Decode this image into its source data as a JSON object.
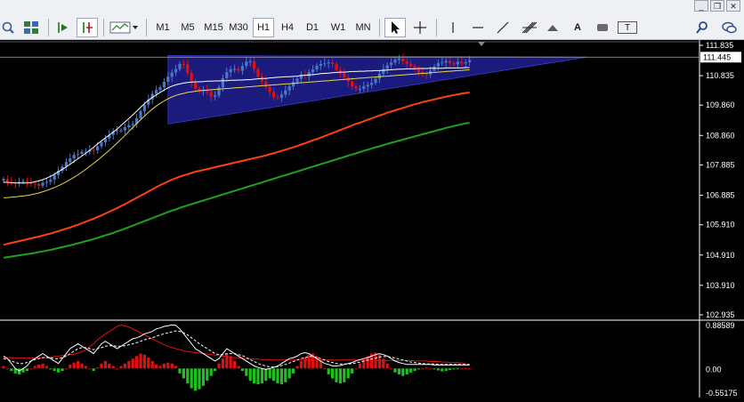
{
  "window": {
    "minimize": "_",
    "restore": "❐",
    "close": "✕"
  },
  "toolbar": {
    "timeframes": [
      "M1",
      "M5",
      "M15",
      "M30",
      "H1",
      "H4",
      "D1",
      "W1",
      "MN"
    ],
    "active_timeframe": "H1",
    "text_tool": "A",
    "label_tool": "T"
  },
  "chart_data": {
    "type": "candlestick",
    "price_axis_ticks": [
      "111.835",
      "110.835",
      "109.860",
      "108.860",
      "107.885",
      "106.885",
      "105.910",
      "104.910",
      "103.910",
      "102.935"
    ],
    "current_price": "111.445",
    "indicator_axis_ticks": [
      "0.88589",
      "0.00",
      "-0.55175"
    ],
    "ylim": [
      102.935,
      111.835
    ],
    "indicator_ylim": [
      -0.55175,
      0.88589
    ],
    "colors": {
      "bull": "#4a78c8",
      "bear": "#e01010",
      "triangle": "#1e1e8c",
      "ma_fast": "#ffffff",
      "ma_mid": "#e8d84a",
      "ma_slow": "#ff4010",
      "ma_long": "#20a020",
      "hist_pos": "#e01010",
      "hist_neg": "#20c020"
    },
    "close": [
      107.42,
      107.33,
      107.31,
      107.28,
      107.33,
      107.35,
      107.3,
      107.27,
      107.25,
      107.2,
      107.3,
      107.33,
      107.4,
      107.55,
      107.69,
      107.83,
      107.98,
      108.1,
      108.22,
      108.25,
      108.32,
      108.32,
      108.38,
      108.37,
      108.5,
      108.63,
      108.76,
      108.88,
      109.0,
      109.03,
      109.03,
      109.13,
      109.2,
      109.24,
      109.43,
      109.66,
      109.87,
      110.05,
      110.24,
      110.36,
      110.45,
      110.63,
      110.8,
      110.94,
      111.05,
      111.22,
      111.21,
      110.92,
      110.6,
      110.4,
      110.32,
      110.36,
      110.3,
      110.14,
      110.18,
      110.45,
      110.75,
      110.95,
      111.05,
      111.06,
      111.0,
      111.15,
      111.3,
      111.31,
      111.05,
      110.8,
      110.64,
      110.46,
      110.3,
      110.12,
      110.11,
      110.21,
      110.35,
      110.48,
      110.62,
      110.73,
      110.86,
      110.81,
      110.95,
      111.04,
      111.16,
      111.22,
      111.24,
      111.27,
      111.22,
      111.01,
      110.9,
      110.78,
      110.64,
      110.48,
      110.4,
      110.4,
      110.48,
      110.53,
      110.6,
      110.73,
      110.9,
      111.06,
      111.18,
      111.27,
      111.36,
      111.4,
      111.31,
      111.23,
      111.15,
      111.04,
      110.95,
      110.89,
      110.88,
      111.0,
      111.14,
      111.25,
      111.27,
      111.32,
      111.25,
      111.21,
      111.3,
      111.24,
      111.28,
      111.35
    ],
    "ma_fast": [
      107.32,
      107.31,
      107.3,
      107.29,
      107.29,
      107.29,
      107.29,
      107.3,
      107.33,
      107.36,
      107.4,
      107.45,
      107.51,
      107.58,
      107.66,
      107.74,
      107.82,
      107.91,
      108.0,
      108.09,
      108.18,
      108.27,
      108.37,
      108.47,
      108.58,
      108.68,
      108.78,
      108.87,
      108.97,
      109.07,
      109.19,
      109.3,
      109.42,
      109.54,
      109.66,
      109.79,
      109.91,
      110.02,
      110.12,
      110.2,
      110.28,
      110.36,
      110.43,
      110.49,
      110.53,
      110.56,
      110.59,
      110.61,
      110.62,
      110.63,
      110.63,
      110.64,
      110.65,
      110.65,
      110.66,
      110.66,
      110.67,
      110.67,
      110.68,
      110.68,
      110.69,
      110.69,
      110.7,
      110.7,
      110.72,
      110.73,
      110.74,
      110.74,
      110.76,
      110.77,
      110.78,
      110.79,
      110.8,
      110.8,
      110.81,
      110.82,
      110.84,
      110.85,
      110.86,
      110.87,
      110.88,
      110.9,
      110.91,
      110.92,
      110.93,
      110.94,
      110.95,
      110.95,
      110.96,
      110.97,
      110.97,
      110.98,
      110.98,
      110.99,
      110.99,
      111.0,
      111.0,
      111.01,
      111.02,
      111.03,
      111.04,
      111.05,
      111.05,
      111.06,
      111.06,
      111.06,
      111.07,
      111.07,
      111.07,
      111.08,
      111.08,
      111.08,
      111.08,
      111.09,
      111.09,
      111.09,
      111.09,
      111.09,
      111.1,
      111.1
    ],
    "ma_mid": [
      106.8,
      106.81,
      106.82,
      106.83,
      106.85,
      106.86,
      106.88,
      106.9,
      106.93,
      106.96,
      107.0,
      107.04,
      107.09,
      107.14,
      107.2,
      107.26,
      107.33,
      107.4,
      107.48,
      107.56,
      107.65,
      107.74,
      107.84,
      107.94,
      108.04,
      108.15,
      108.26,
      108.37,
      108.49,
      108.61,
      108.73,
      108.86,
      108.99,
      109.12,
      109.25,
      109.38,
      109.5,
      109.62,
      109.73,
      109.83,
      109.92,
      110.0,
      110.07,
      110.13,
      110.18,
      110.22,
      110.25,
      110.28,
      110.3,
      110.32,
      110.34,
      110.35,
      110.36,
      110.37,
      110.38,
      110.39,
      110.4,
      110.41,
      110.42,
      110.43,
      110.44,
      110.45,
      110.46,
      110.47,
      110.48,
      110.49,
      110.5,
      110.51,
      110.52,
      110.53,
      110.54,
      110.55,
      110.56,
      110.57,
      110.58,
      110.59,
      110.6,
      110.61,
      110.62,
      110.63,
      110.64,
      110.65,
      110.66,
      110.67,
      110.68,
      110.69,
      110.7,
      110.71,
      110.72,
      110.73,
      110.74,
      110.75,
      110.76,
      110.77,
      110.78,
      110.79,
      110.8,
      110.81,
      110.82,
      110.83,
      110.84,
      110.85,
      110.86,
      110.87,
      110.88,
      110.89,
      110.9,
      110.91,
      110.92,
      110.93,
      110.94,
      110.95,
      110.96,
      110.97,
      110.98,
      110.99,
      111.0,
      111.01,
      111.02,
      111.03
    ],
    "ma_slow": [
      105.25,
      105.28,
      105.31,
      105.34,
      105.37,
      105.4,
      105.43,
      105.46,
      105.49,
      105.52,
      105.55,
      105.59,
      105.62,
      105.66,
      105.7,
      105.74,
      105.78,
      105.82,
      105.87,
      105.91,
      105.96,
      106.01,
      106.06,
      106.11,
      106.17,
      106.22,
      106.28,
      106.34,
      106.4,
      106.46,
      106.53,
      106.59,
      106.66,
      106.73,
      106.8,
      106.87,
      106.94,
      107.01,
      107.08,
      107.15,
      107.22,
      107.28,
      107.34,
      107.4,
      107.45,
      107.5,
      107.54,
      107.58,
      107.62,
      107.66,
      107.69,
      107.72,
      107.75,
      107.78,
      107.81,
      107.84,
      107.87,
      107.9,
      107.93,
      107.96,
      107.99,
      108.02,
      108.05,
      108.08,
      108.11,
      108.14,
      108.17,
      108.2,
      108.24,
      108.27,
      108.31,
      108.35,
      108.39,
      108.43,
      108.47,
      108.51,
      108.56,
      108.6,
      108.65,
      108.7,
      108.74,
      108.79,
      108.84,
      108.89,
      108.94,
      108.99,
      109.04,
      109.09,
      109.14,
      109.19,
      109.24,
      109.28,
      109.33,
      109.38,
      109.42,
      109.47,
      109.52,
      109.56,
      109.61,
      109.65,
      109.69,
      109.73,
      109.77,
      109.81,
      109.85,
      109.89,
      109.92,
      109.96,
      109.99,
      110.02,
      110.05,
      110.08,
      110.11,
      110.14,
      110.17,
      110.19,
      110.22,
      110.24,
      110.26,
      110.28
    ],
    "ma_long": [
      104.82,
      104.84,
      104.86,
      104.88,
      104.9,
      104.92,
      104.94,
      104.96,
      104.98,
      105.01,
      105.03,
      105.06,
      105.08,
      105.11,
      105.14,
      105.17,
      105.2,
      105.23,
      105.26,
      105.3,
      105.33,
      105.37,
      105.4,
      105.44,
      105.48,
      105.52,
      105.56,
      105.6,
      105.64,
      105.69,
      105.73,
      105.78,
      105.83,
      105.88,
      105.93,
      105.98,
      106.03,
      106.08,
      106.13,
      106.18,
      106.23,
      106.28,
      106.33,
      106.38,
      106.42,
      106.47,
      106.51,
      106.55,
      106.59,
      106.63,
      106.67,
      106.71,
      106.75,
      106.79,
      106.83,
      106.87,
      106.91,
      106.95,
      106.99,
      107.03,
      107.07,
      107.11,
      107.15,
      107.19,
      107.23,
      107.27,
      107.31,
      107.35,
      107.39,
      107.43,
      107.47,
      107.51,
      107.55,
      107.59,
      107.63,
      107.67,
      107.71,
      107.75,
      107.79,
      107.83,
      107.87,
      107.91,
      107.95,
      107.99,
      108.03,
      108.07,
      108.11,
      108.15,
      108.19,
      108.23,
      108.27,
      108.31,
      108.35,
      108.39,
      108.43,
      108.47,
      108.5,
      108.54,
      108.58,
      108.62,
      108.65,
      108.69,
      108.72,
      108.76,
      108.79,
      108.83,
      108.86,
      108.9,
      108.93,
      108.97,
      109.0,
      109.04,
      109.07,
      109.11,
      109.14,
      109.17,
      109.2,
      109.23,
      109.26,
      109.28
    ],
    "triangle": {
      "apex_price": 111.45,
      "top_price": 111.5,
      "bottom_price": 109.24
    },
    "histogram": [
      0.05,
      0.0,
      -0.05,
      -0.1,
      -0.12,
      -0.08,
      -0.05,
      0.0,
      0.05,
      0.08,
      0.1,
      0.05,
      -0.02,
      -0.05,
      -0.08,
      -0.05,
      0.0,
      0.08,
      0.12,
      0.15,
      0.1,
      0.05,
      0.0,
      -0.05,
      0.02,
      0.1,
      0.15,
      0.1,
      0.05,
      0.0,
      0.05,
      0.1,
      0.15,
      0.2,
      0.25,
      0.3,
      0.28,
      0.22,
      0.15,
      0.08,
      0.05,
      0.1,
      0.12,
      0.1,
      0.05,
      -0.1,
      -0.2,
      -0.3,
      -0.4,
      -0.45,
      -0.42,
      -0.35,
      -0.25,
      -0.15,
      -0.05,
      0.1,
      0.2,
      0.3,
      0.25,
      0.15,
      0.05,
      -0.05,
      -0.15,
      -0.25,
      -0.3,
      -0.32,
      -0.3,
      -0.25,
      -0.2,
      -0.25,
      -0.3,
      -0.32,
      -0.28,
      -0.2,
      -0.1,
      0.05,
      0.15,
      0.22,
      0.28,
      0.3,
      0.25,
      0.15,
      0.0,
      -0.12,
      -0.2,
      -0.28,
      -0.3,
      -0.28,
      -0.2,
      -0.1,
      0.0,
      0.1,
      0.18,
      0.25,
      0.3,
      0.32,
      0.28,
      0.2,
      0.1,
      0.0,
      -0.08,
      -0.12,
      -0.15,
      -0.12,
      -0.08,
      -0.05,
      -0.02,
      0.0,
      0.02,
      0.0,
      -0.02,
      -0.04,
      -0.06,
      -0.05,
      -0.03,
      -0.02,
      -0.01,
      0.0,
      0.01,
      0.0
    ],
    "signal_white": [
      0.25,
      0.2,
      0.1,
      0.0,
      -0.05,
      0.0,
      0.05,
      0.15,
      0.2,
      0.25,
      0.3,
      0.25,
      0.2,
      0.15,
      0.1,
      0.2,
      0.3,
      0.4,
      0.45,
      0.5,
      0.45,
      0.4,
      0.35,
      0.3,
      0.4,
      0.5,
      0.55,
      0.5,
      0.45,
      0.4,
      0.45,
      0.5,
      0.55,
      0.6,
      0.62,
      0.65,
      0.7,
      0.72,
      0.75,
      0.8,
      0.82,
      0.85,
      0.86,
      0.88,
      0.87,
      0.8,
      0.7,
      0.6,
      0.5,
      0.4,
      0.35,
      0.3,
      0.25,
      0.2,
      0.15,
      0.2,
      0.3,
      0.4,
      0.35,
      0.3,
      0.25,
      0.2,
      0.15,
      0.1,
      0.05,
      0.02,
      0.0,
      -0.02,
      0.0,
      0.02,
      0.05,
      0.1,
      0.15,
      0.2,
      0.22,
      0.25,
      0.3,
      0.32,
      0.3,
      0.25,
      0.2,
      0.15,
      0.1,
      0.08,
      0.05,
      0.05,
      0.06,
      0.08,
      0.1,
      0.12,
      0.15,
      0.18,
      0.2,
      0.22,
      0.25,
      0.28,
      0.3,
      0.28,
      0.25,
      0.2,
      0.15,
      0.12,
      0.1,
      0.08,
      0.08,
      0.08,
      0.08,
      0.08,
      0.08,
      0.08,
      0.07,
      0.07,
      0.07,
      0.07,
      0.07,
      0.07,
      0.07,
      0.07,
      0.07,
      0.07
    ],
    "signal_dashed": [
      0.2,
      0.18,
      0.15,
      0.12,
      0.1,
      0.1,
      0.12,
      0.15,
      0.18,
      0.2,
      0.22,
      0.22,
      0.22,
      0.2,
      0.2,
      0.22,
      0.25,
      0.3,
      0.35,
      0.4,
      0.42,
      0.42,
      0.4,
      0.38,
      0.4,
      0.42,
      0.45,
      0.46,
      0.46,
      0.45,
      0.45,
      0.46,
      0.48,
      0.5,
      0.52,
      0.55,
      0.58,
      0.6,
      0.62,
      0.65,
      0.68,
      0.7,
      0.72,
      0.74,
      0.76,
      0.75,
      0.72,
      0.68,
      0.62,
      0.56,
      0.5,
      0.45,
      0.4,
      0.35,
      0.3,
      0.28,
      0.28,
      0.3,
      0.3,
      0.3,
      0.28,
      0.26,
      0.22,
      0.18,
      0.14,
      0.1,
      0.07,
      0.05,
      0.03,
      0.03,
      0.04,
      0.06,
      0.08,
      0.11,
      0.14,
      0.17,
      0.2,
      0.22,
      0.24,
      0.24,
      0.22,
      0.2,
      0.17,
      0.14,
      0.12,
      0.1,
      0.09,
      0.09,
      0.09,
      0.1,
      0.11,
      0.13,
      0.15,
      0.17,
      0.19,
      0.21,
      0.23,
      0.24,
      0.24,
      0.23,
      0.21,
      0.19,
      0.17,
      0.15,
      0.13,
      0.12,
      0.11,
      0.1,
      0.09,
      0.09,
      0.09,
      0.08,
      0.08,
      0.08,
      0.08,
      0.08,
      0.08,
      0.08,
      0.08,
      0.08
    ],
    "red_trendline": [
      0.22,
      0.22,
      0.22,
      0.21,
      0.21,
      0.21,
      0.21,
      0.21,
      0.21,
      0.21,
      0.22,
      0.22,
      0.23,
      0.24,
      0.25,
      0.26,
      0.27,
      0.28,
      0.29,
      0.31,
      0.34,
      0.38,
      0.44,
      0.5,
      0.58,
      0.64,
      0.7,
      0.75,
      0.8,
      0.85,
      0.88,
      0.86,
      0.84,
      0.8,
      0.76,
      0.72,
      0.68,
      0.64,
      0.6,
      0.56,
      0.52,
      0.48,
      0.45,
      0.42,
      0.4,
      0.38,
      0.36,
      0.34,
      0.33,
      0.32,
      0.31,
      0.3,
      0.29,
      0.28,
      0.27,
      0.26,
      0.25,
      0.24,
      0.23,
      0.22,
      0.22,
      0.21,
      0.2,
      0.2,
      0.19,
      0.19,
      0.18,
      0.18,
      0.18,
      0.17,
      0.17,
      0.17,
      0.17,
      0.17,
      0.17,
      0.17,
      0.17,
      0.17,
      0.17,
      0.17,
      0.17,
      0.17,
      0.17,
      0.17,
      0.17,
      0.17,
      0.17,
      0.17,
      0.17,
      0.17,
      0.17,
      0.17,
      0.17,
      0.17,
      0.17,
      0.16,
      0.16,
      0.16,
      0.16,
      0.16,
      0.16,
      0.16,
      0.16,
      0.16,
      0.16,
      0.15,
      0.15,
      0.15,
      0.15,
      0.14,
      0.14,
      0.14,
      0.13,
      0.13,
      0.12,
      0.12,
      0.12,
      0.11,
      0.11
    ]
  }
}
